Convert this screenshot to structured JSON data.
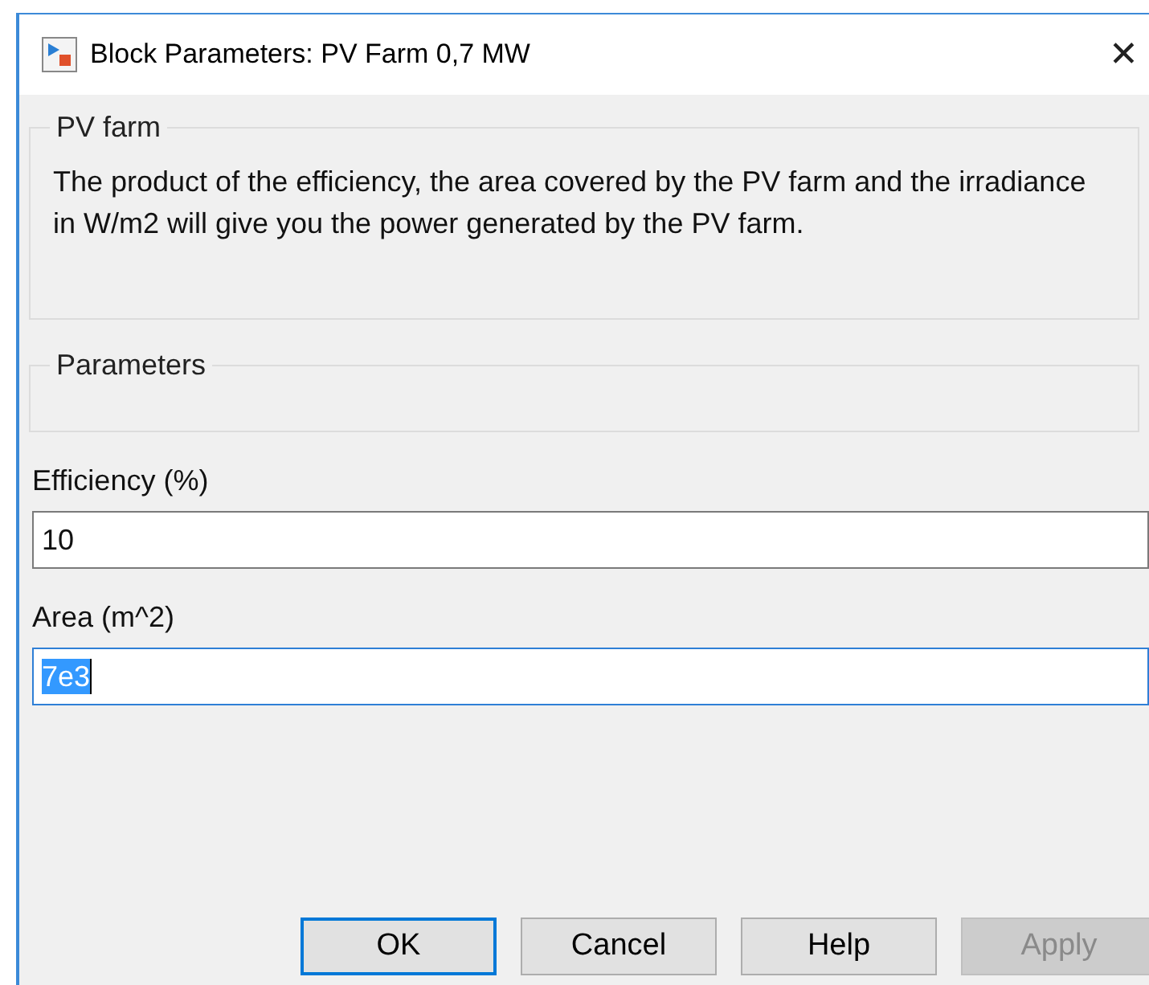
{
  "window": {
    "title": "Block Parameters: PV Farm 0,7 MW",
    "close": "✕"
  },
  "description_group": {
    "title": "PV farm",
    "text": "The product of the efficiency, the area covered by the PV farm and the irradiance in W/m2 will give you the power generated by the PV farm."
  },
  "parameters_group": {
    "title": "Parameters"
  },
  "fields": [
    {
      "label": "Efficiency (%)",
      "value": "10",
      "focused": false
    },
    {
      "label": "Area (m^2)",
      "value": "7e3",
      "focused": true
    }
  ],
  "buttons": [
    {
      "label": "OK",
      "default": true,
      "disabled": false
    },
    {
      "label": "Cancel",
      "default": false,
      "disabled": false
    },
    {
      "label": "Help",
      "default": false,
      "disabled": false
    },
    {
      "label": "Apply",
      "default": false,
      "disabled": true
    }
  ]
}
